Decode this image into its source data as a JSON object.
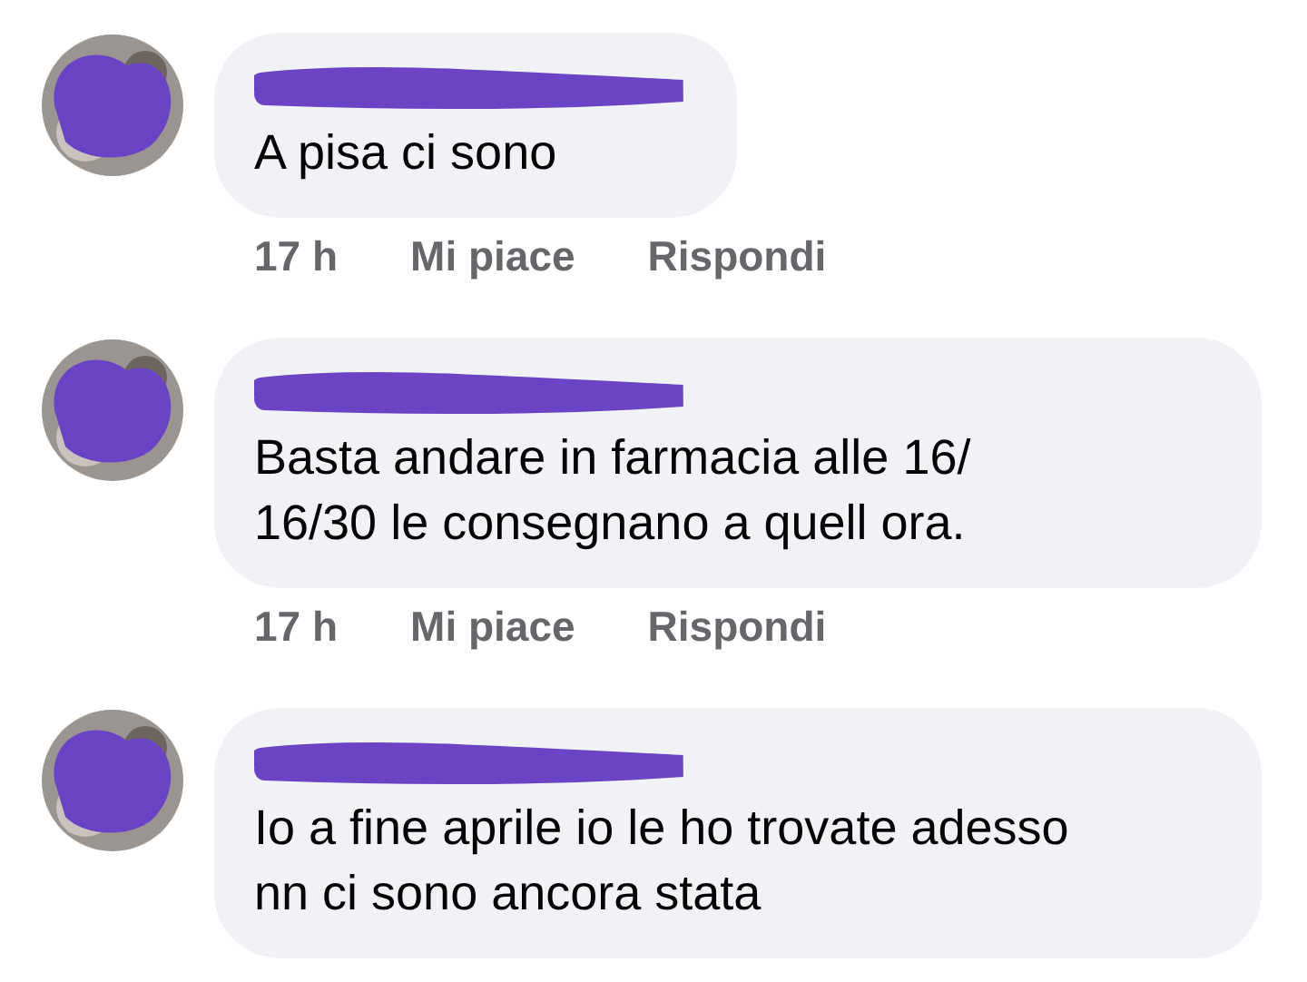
{
  "comments": [
    {
      "lines": [
        "A pisa ci sono"
      ],
      "meta": {
        "time": "17 h",
        "like": "Mi piace",
        "reply": "Rispondi"
      }
    },
    {
      "lines": [
        "Basta andare in farmacia alle 16/",
        "16/30 le consegnano a quell ora."
      ],
      "meta": {
        "time": "17 h",
        "like": "Mi piace",
        "reply": "Rispondi"
      }
    },
    {
      "lines": [
        "Io a fine aprile io le ho trovate adesso",
        "nn ci sono ancora stata"
      ]
    }
  ]
}
